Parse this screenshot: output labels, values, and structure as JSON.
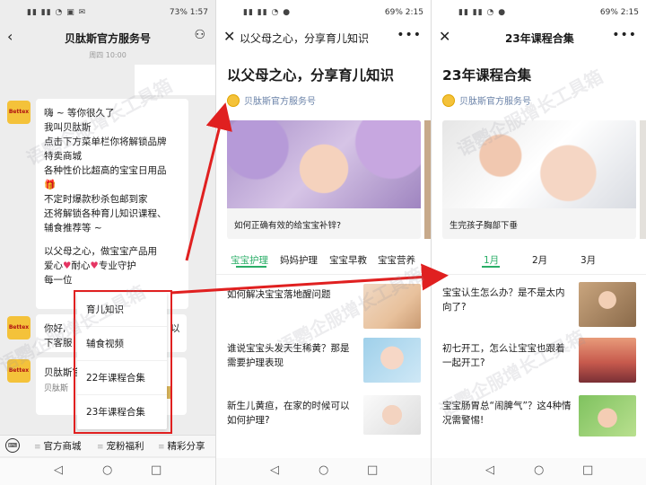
{
  "phone1": {
    "status": {
      "battery": "73%",
      "time": "1:57"
    },
    "title": "贝肽斯官方服务号",
    "timestamp": "周四 10:00",
    "avatar_label": "Bettex",
    "welcome_lines": [
      "嗨 ~ 等你很久了",
      "我叫贝肽斯",
      "点击下方菜单栏你将解锁品牌",
      "特卖商城",
      "各种性价比超高的宝宝日用品",
      "不定时爆款秒杀包邮到家",
      "还将解锁各种育儿知识课程、",
      "辅食推荐等 ~",
      "",
      "以父母之心，做宝宝产品用",
      "爱心",
      "耐心",
      "专业守护",
      "每一位"
    ],
    "msg2_lines": [
      "你好,",
      "下客服"
    ],
    "msg2_tail": "以",
    "card": {
      "title": "贝肽斯官",
      "sub": "贝肽斯"
    },
    "popup_items": [
      "育儿知识",
      "辅食视频",
      "22年课程合集",
      "23年课程合集"
    ],
    "bottom_menu": [
      "官方商城",
      "宠粉福利",
      "精彩分享"
    ]
  },
  "phone2": {
    "status": {
      "battery": "69%",
      "time": "2:15"
    },
    "title": "以父母之心，分享育儿知识",
    "heading": "以父母之心，分享育儿知识",
    "account": "贝肽斯官方服务号",
    "hero_caption": "如何正确有效的给宝宝补锌?",
    "tabs": [
      "宝宝护理",
      "妈妈护理",
      "宝宝早教",
      "宝宝营养"
    ],
    "articles": [
      "如何解决宝宝落地醒问题",
      "谁说宝宝头发天生稀黄？那是需要护理表现",
      "新生儿黄疸，在家的时候可以如何护理?"
    ]
  },
  "phone3": {
    "status": {
      "battery": "69%",
      "time": "2:15"
    },
    "title": "23年课程合集",
    "heading": "23年课程合集",
    "account": "贝肽斯官方服务号",
    "hero_caption": "生完孩子胸部下垂",
    "tabs": [
      "1月",
      "2月",
      "3月"
    ],
    "articles": [
      "宝宝认生怎么办？是不是太内向了?",
      "初七开工，怎么让宝宝也跟着一起开工?",
      "宝宝肠胃总“闹脾气”？这4种情况需警惕!"
    ]
  },
  "watermark": "语鹦企服增长工具箱",
  "colors": {
    "accent_green": "#2aae67",
    "annotation_red": "#e02020",
    "link_blue": "#6a82a8",
    "chat_bg": "#ededed",
    "brand_yellow": "#f4c23a"
  },
  "icons": [
    "back-icon",
    "profile-icon",
    "close-icon",
    "more-icon",
    "keyboard-icon",
    "nav-back-icon",
    "nav-home-icon",
    "nav-recent-icon",
    "gift-icon",
    "heart-icon"
  ]
}
